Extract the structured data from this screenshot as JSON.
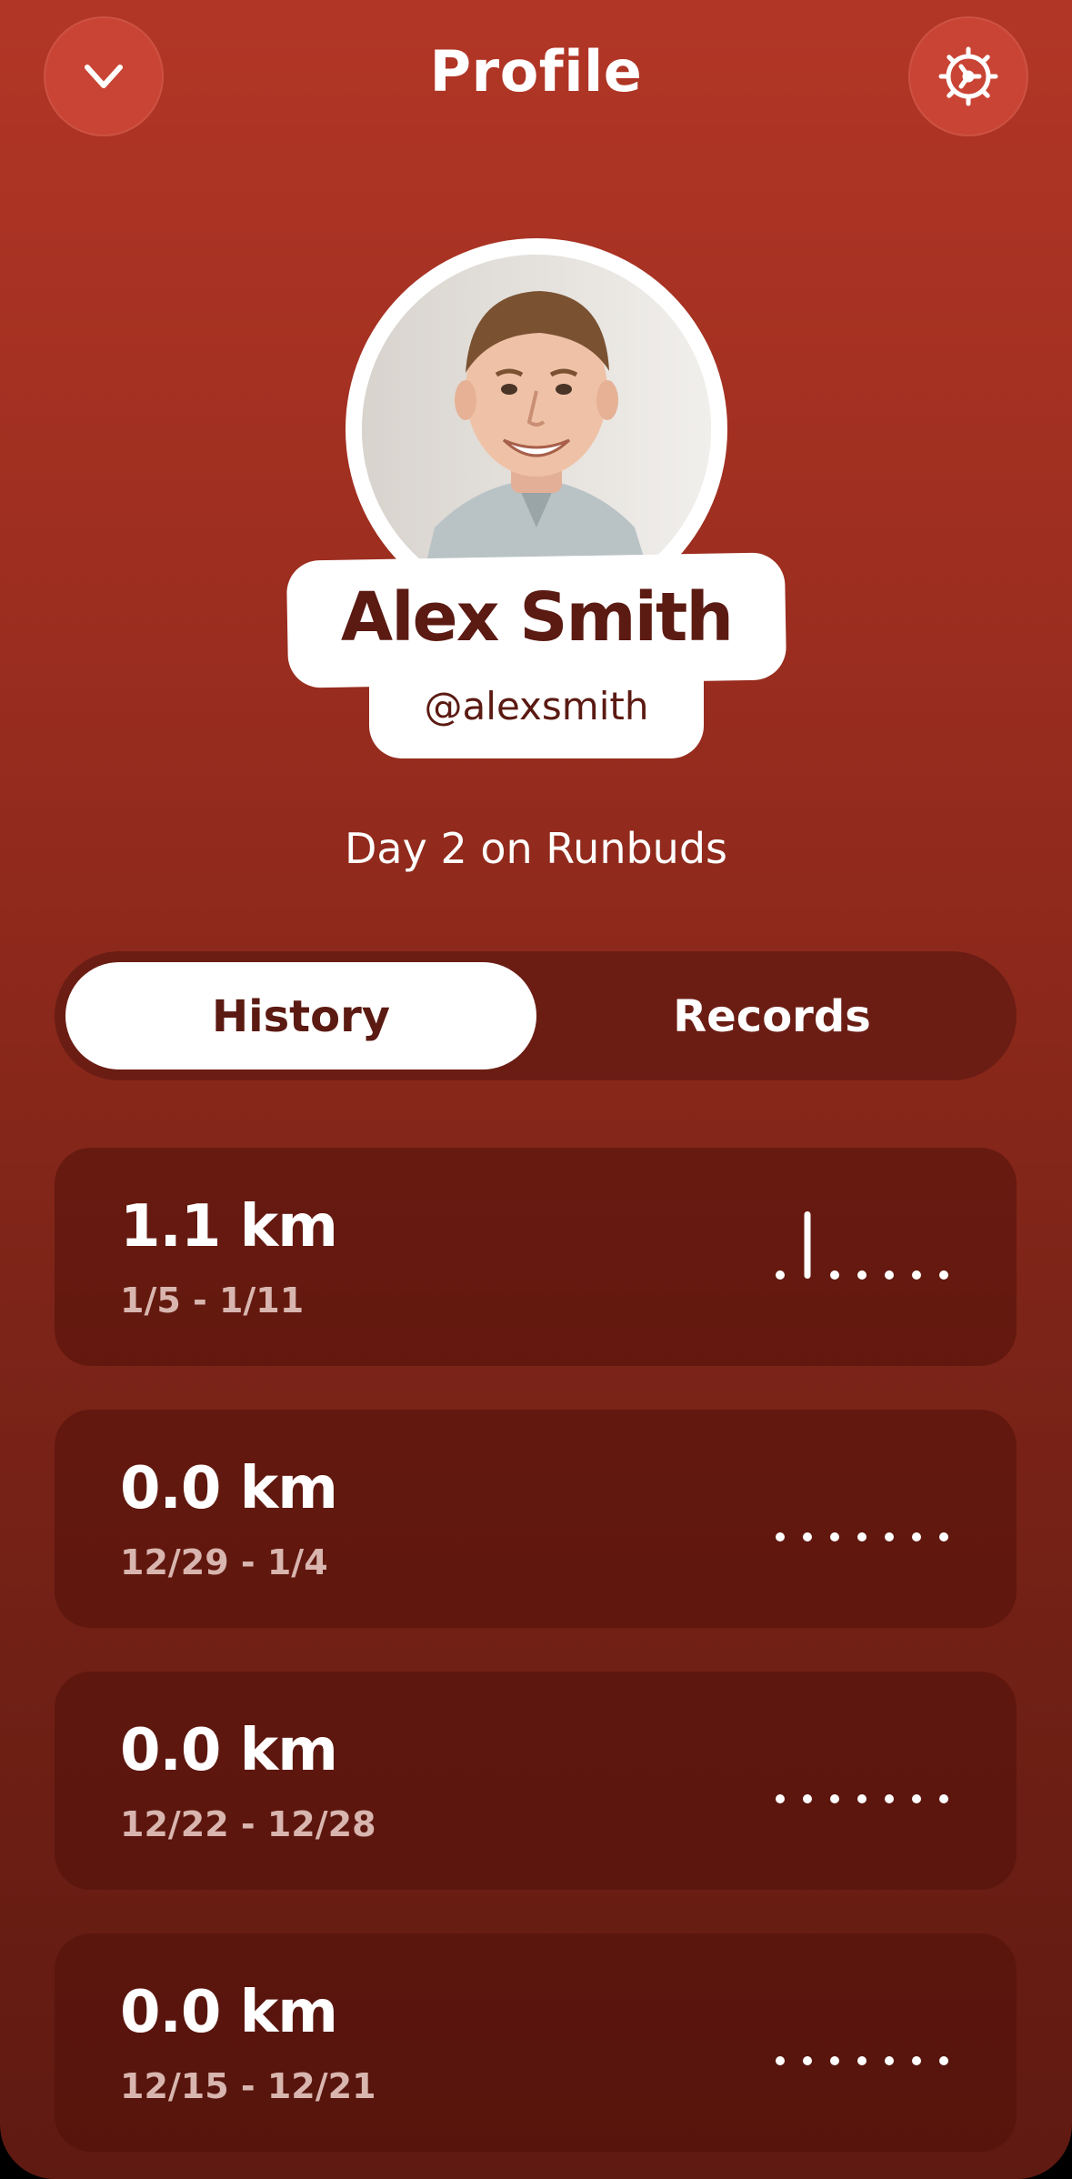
{
  "header": {
    "title": "Profile",
    "left_icon": "chevron-down-icon",
    "right_icon": "gear-icon"
  },
  "profile": {
    "name": "Alex Smith",
    "handle": "@alexsmith",
    "day_text": "Day 2 on Runbuds"
  },
  "tabs": {
    "history": "History",
    "records": "Records",
    "active": "History"
  },
  "history": [
    {
      "distance": "1.1 km",
      "range": "1/5 - 1/11",
      "daily_bars": [
        0,
        1,
        0,
        0,
        0,
        0,
        0
      ]
    },
    {
      "distance": "0.0 km",
      "range": "12/29 - 1/4",
      "daily_bars": [
        0,
        0,
        0,
        0,
        0,
        0,
        0
      ]
    },
    {
      "distance": "0.0 km",
      "range": "12/22 - 12/28",
      "daily_bars": [
        0,
        0,
        0,
        0,
        0,
        0,
        0
      ]
    },
    {
      "distance": "0.0 km",
      "range": "12/15 - 12/21",
      "daily_bars": [
        0,
        0,
        0,
        0,
        0,
        0,
        0
      ]
    }
  ],
  "colors": {
    "accent": "#b23626",
    "dark": "#5b1a12",
    "text_light": "#ffffff"
  }
}
